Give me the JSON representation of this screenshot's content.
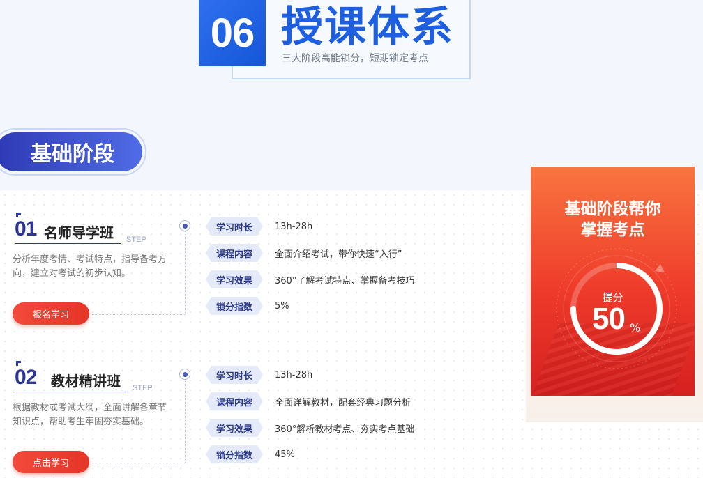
{
  "header": {
    "number": "06",
    "title": "授课体系",
    "subtitle": "三大阶段高能锁分，短期锁定考点"
  },
  "stage": {
    "label": "基础阶段"
  },
  "step_word": "STEP",
  "courses": [
    {
      "number": "01",
      "name": "名师导学班",
      "description": "分析年度考情、考试特点，指导备考方向，建立对考试的初步认知。",
      "button": "报名学习",
      "rows": [
        {
          "tag": "学习时长",
          "value": "13h-28h"
        },
        {
          "tag": "课程内容",
          "value": "全面介绍考试，带你快速“入行”"
        },
        {
          "tag": "学习效果",
          "value": "360°了解考试特点、掌握备考技巧"
        },
        {
          "tag": "锁分指数",
          "value": "5%"
        }
      ]
    },
    {
      "number": "02",
      "name": "教材精讲班",
      "description": "根据教材或考试大纲，全面讲解各章节知识点，帮助考生牢固夯实基础。",
      "button": "点击学习",
      "rows": [
        {
          "tag": "学习时长",
          "value": "13h-28h"
        },
        {
          "tag": "课程内容",
          "value": "全面详解教材，配套经典习题分析"
        },
        {
          "tag": "学习效果",
          "value": "360°解析教材考点、夯实考点基础"
        },
        {
          "tag": "锁分指数",
          "value": "45%"
        }
      ]
    }
  ],
  "promo": {
    "title_line1": "基础阶段帮你",
    "title_line2": "掌握考点",
    "label": "提分",
    "percent": "50",
    "unit": "%",
    "progress": 0.75
  },
  "colors": {
    "accent_blue": "#1d5fe0",
    "navy": "#2c3595",
    "button_red": "#e53526",
    "promo_orange": "#f9753f",
    "promo_red": "#d52020"
  }
}
